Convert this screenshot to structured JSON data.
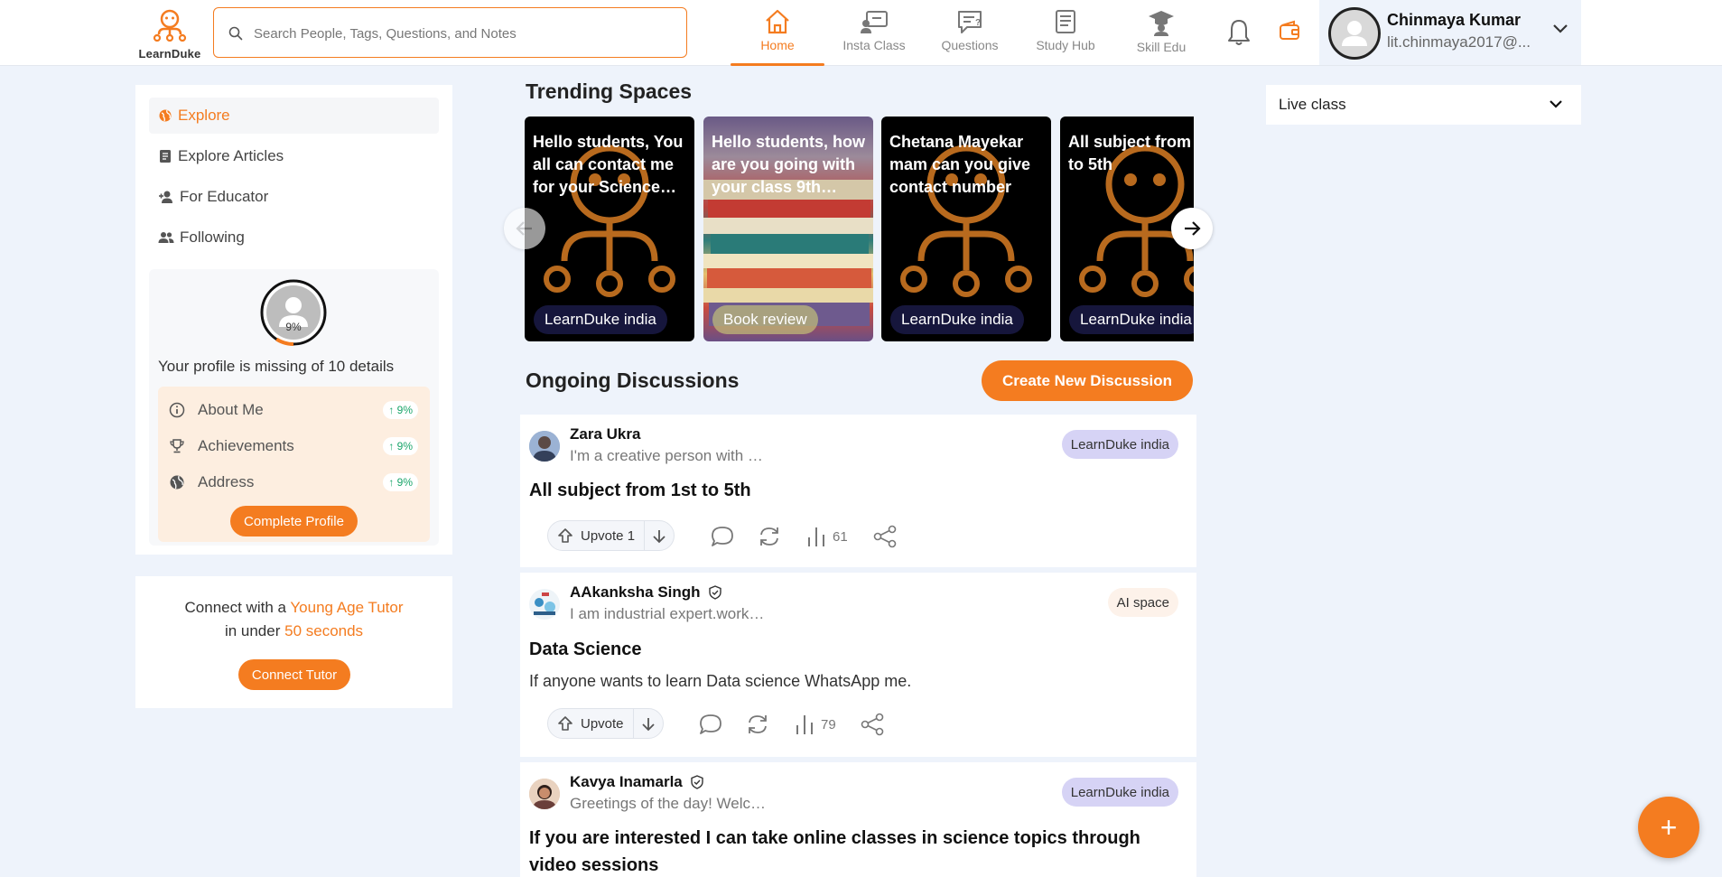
{
  "header": {
    "logo_text": "LearnDuke",
    "search_placeholder": "Search People, Tags, Questions, and Notes",
    "nav": [
      {
        "label": "Home",
        "icon": "home-icon",
        "active": true
      },
      {
        "label": "Insta Class",
        "icon": "insta-class-icon",
        "active": false
      },
      {
        "label": "Questions",
        "icon": "questions-icon",
        "active": false
      },
      {
        "label": "Study Hub",
        "icon": "study-hub-icon",
        "active": false
      },
      {
        "label": "Skill Edu",
        "icon": "skill-edu-icon",
        "active": false
      }
    ],
    "user": {
      "name": "Chinmaya Kumar",
      "email": "lit.chinmaya2017@..."
    }
  },
  "sidebar": {
    "items": [
      {
        "label": "Explore",
        "icon": "globe-icon",
        "active": true
      },
      {
        "label": "Explore Articles",
        "icon": "article-icon",
        "active": false
      },
      {
        "label": "For Educator",
        "icon": "add-person-icon",
        "active": false
      },
      {
        "label": "Following",
        "icon": "people-icon",
        "active": false
      }
    ],
    "profile": {
      "percent_label": "9%",
      "progress": 0.09,
      "missing_text": "Your profile is missing of 10 details",
      "details": [
        {
          "label": "About Me",
          "badge": "9%",
          "icon": "info-icon"
        },
        {
          "label": "Achievements",
          "badge": "9%",
          "icon": "trophy-icon"
        },
        {
          "label": "Address",
          "badge": "9%",
          "icon": "globe-icon"
        }
      ],
      "complete_button": "Complete Profile"
    },
    "connect": {
      "pre": "Connect with a ",
      "highlight1": "Young Age Tutor",
      "mid": "in under ",
      "highlight2": "50 seconds",
      "button": "Connect Tutor"
    }
  },
  "trending": {
    "title": "Trending Spaces",
    "cards": [
      {
        "text": "Hello students, You all can contact me for your Science…",
        "tag": "LearnDuke india"
      },
      {
        "text": "Hello students, how are you going with your class 9th…",
        "tag": "Book review"
      },
      {
        "text": "Chetana Mayekar mam can you give contact number",
        "tag": "LearnDuke india"
      },
      {
        "text": "All subject from 1st to 5th",
        "tag": "LearnDuke india"
      }
    ]
  },
  "discussions": {
    "title": "Ongoing Discussions",
    "create_button": "Create New Discussion",
    "posts": [
      {
        "author": "Zara Ukra",
        "bio": "I'm a creative person with …",
        "space": "LearnDuke india",
        "title": "All subject from 1st to 5th",
        "body": "",
        "upvote": "Upvote 1",
        "views": "61",
        "verified": false
      },
      {
        "author": "AAkanksha Singh",
        "bio": "I am industrial expert.work…",
        "space": "AI space",
        "title": "Data Science",
        "body": "If anyone wants to learn Data science WhatsApp me.",
        "upvote": "Upvote",
        "views": "79",
        "verified": true
      },
      {
        "author": "Kavya Inamarla",
        "bio": "Greetings of the day! Welc…",
        "space": "LearnDuke india",
        "title": "If you are interested I can take online classes in science topics through video sessions",
        "body": "",
        "upvote": "",
        "views": "",
        "verified": true
      }
    ]
  },
  "right": {
    "live_select": "Live class"
  },
  "fab": "+",
  "colors": {
    "accent": "#f47c20",
    "background": "#eef3fb",
    "success": "#1aa56a"
  }
}
